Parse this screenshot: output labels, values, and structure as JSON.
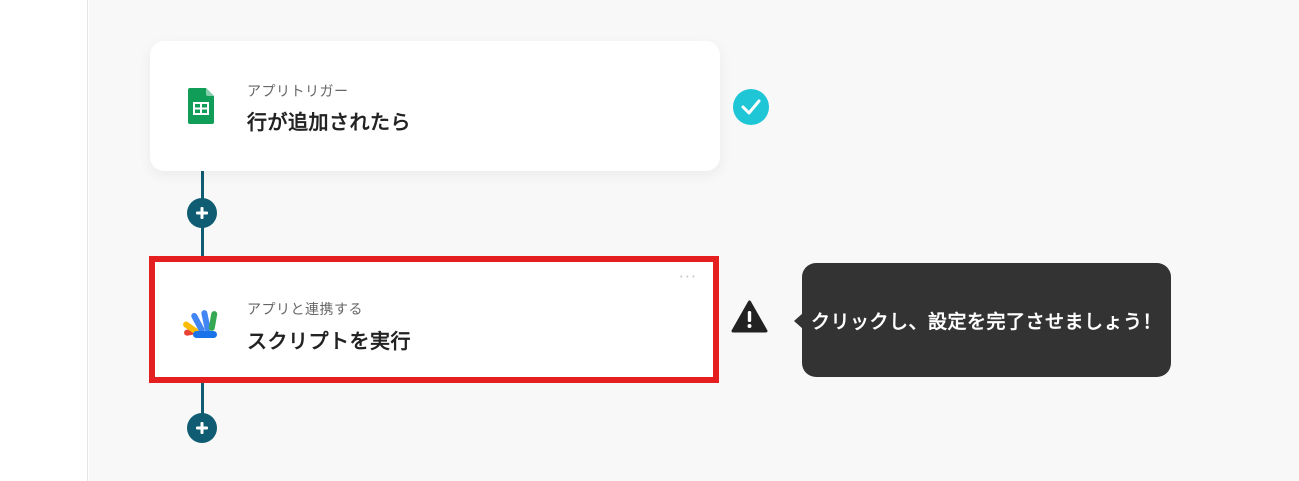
{
  "flow": {
    "trigger": {
      "type_label": "アプリトリガー",
      "title": "行が追加されたら",
      "app_icon": "google-sheets-icon",
      "status_icon": "check-icon",
      "status_color": "#1ec6d6"
    },
    "action": {
      "type_label": "アプリと連携する",
      "title": "スクリプトを実行",
      "app_icon": "google-apps-script-icon",
      "menu": "···",
      "status_icon": "warning-icon",
      "highlight_color": "#e51f1f"
    },
    "add_step_icon": "plus-icon",
    "connector_color": "#0f5c73"
  },
  "tooltip": {
    "text": "クリックし、設定を完了させましょう！"
  }
}
